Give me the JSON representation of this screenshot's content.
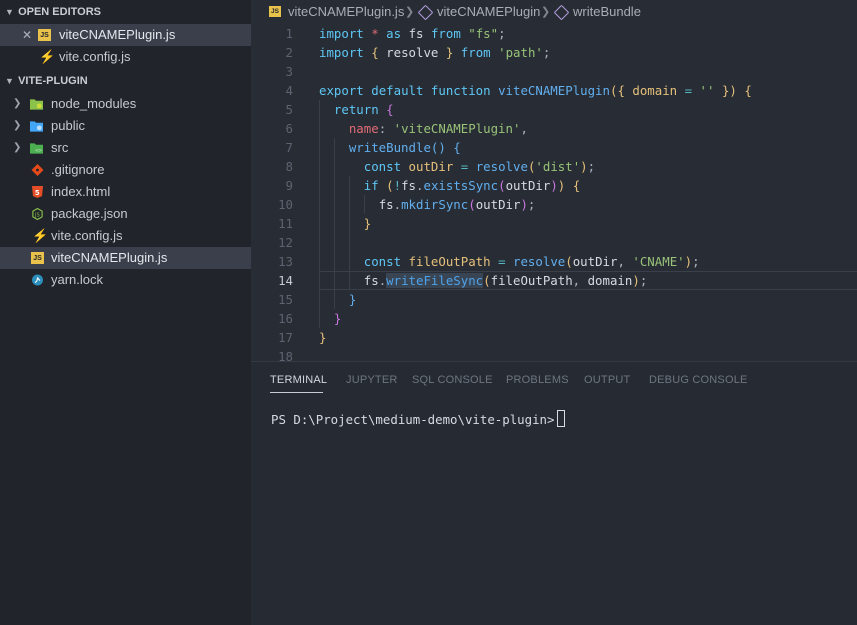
{
  "explorer": {
    "open_editors_header": "OPEN EDITORS",
    "open_editors": [
      {
        "name": "viteCNAMEPlugin.js",
        "icon": "js-file-icon",
        "active": true
      },
      {
        "name": "vite.config.js",
        "icon": "vite-icon",
        "active": false
      }
    ],
    "project_header": "VITE-PLUGIN",
    "tree": [
      {
        "name": "node_modules",
        "icon": "node-folder-icon",
        "type": "folder"
      },
      {
        "name": "public",
        "icon": "public-folder-icon",
        "type": "folder"
      },
      {
        "name": "src",
        "icon": "src-folder-icon",
        "type": "folder"
      },
      {
        "name": ".gitignore",
        "icon": "git-icon",
        "type": "file"
      },
      {
        "name": "index.html",
        "icon": "html5-icon",
        "type": "file"
      },
      {
        "name": "package.json",
        "icon": "nodejs-icon",
        "type": "file"
      },
      {
        "name": "vite.config.js",
        "icon": "vite-icon",
        "type": "file"
      },
      {
        "name": "viteCNAMEPlugin.js",
        "icon": "js-file-icon",
        "type": "file",
        "active": true
      },
      {
        "name": "yarn.lock",
        "icon": "yarn-icon",
        "type": "file"
      }
    ]
  },
  "breadcrumb": {
    "icon_text": "JS",
    "file": "viteCNAMEPlugin.js",
    "symbol1": "viteCNAMEPlugin",
    "symbol2": "writeBundle"
  },
  "editor": {
    "current_line": 14,
    "line_numbers": [
      "1",
      "2",
      "3",
      "4",
      "5",
      "6",
      "7",
      "8",
      "9",
      "10",
      "11",
      "12",
      "13",
      "14",
      "15",
      "16",
      "17",
      "18"
    ],
    "lines": [
      "import * as fs from \"fs\";",
      "import { resolve } from 'path';",
      "",
      "export default function viteCNAMEPlugin({ domain = '' }) {",
      "  return {",
      "    name: 'viteCNAMEPlugin',",
      "    writeBundle() {",
      "      const outDir = resolve('dist');",
      "      if (!fs.existsSync(outDir)) {",
      "        fs.mkdirSync(outDir);",
      "      }",
      "",
      "      const fileOutPath = resolve(outDir, 'CNAME');",
      "      fs.writeFileSync(fileOutPath, domain);",
      "    }",
      "  }",
      "}",
      ""
    ]
  },
  "panel": {
    "tabs": [
      "TERMINAL",
      "JUPYTER",
      "SQL CONSOLE",
      "PROBLEMS",
      "OUTPUT",
      "DEBUG CONSOLE"
    ],
    "active_tab": "TERMINAL",
    "terminal_prompt": "PS D:\\Project\\medium-demo\\vite-plugin>"
  },
  "colors": {
    "sidebar_bg": "#21252b",
    "editor_bg": "#282c34",
    "panel_bg": "#262b33",
    "active_row": "#3a3f4b",
    "keyword": "#5ec7f5",
    "string": "#98c379",
    "function": "#61afef",
    "property": "#e06c75"
  }
}
